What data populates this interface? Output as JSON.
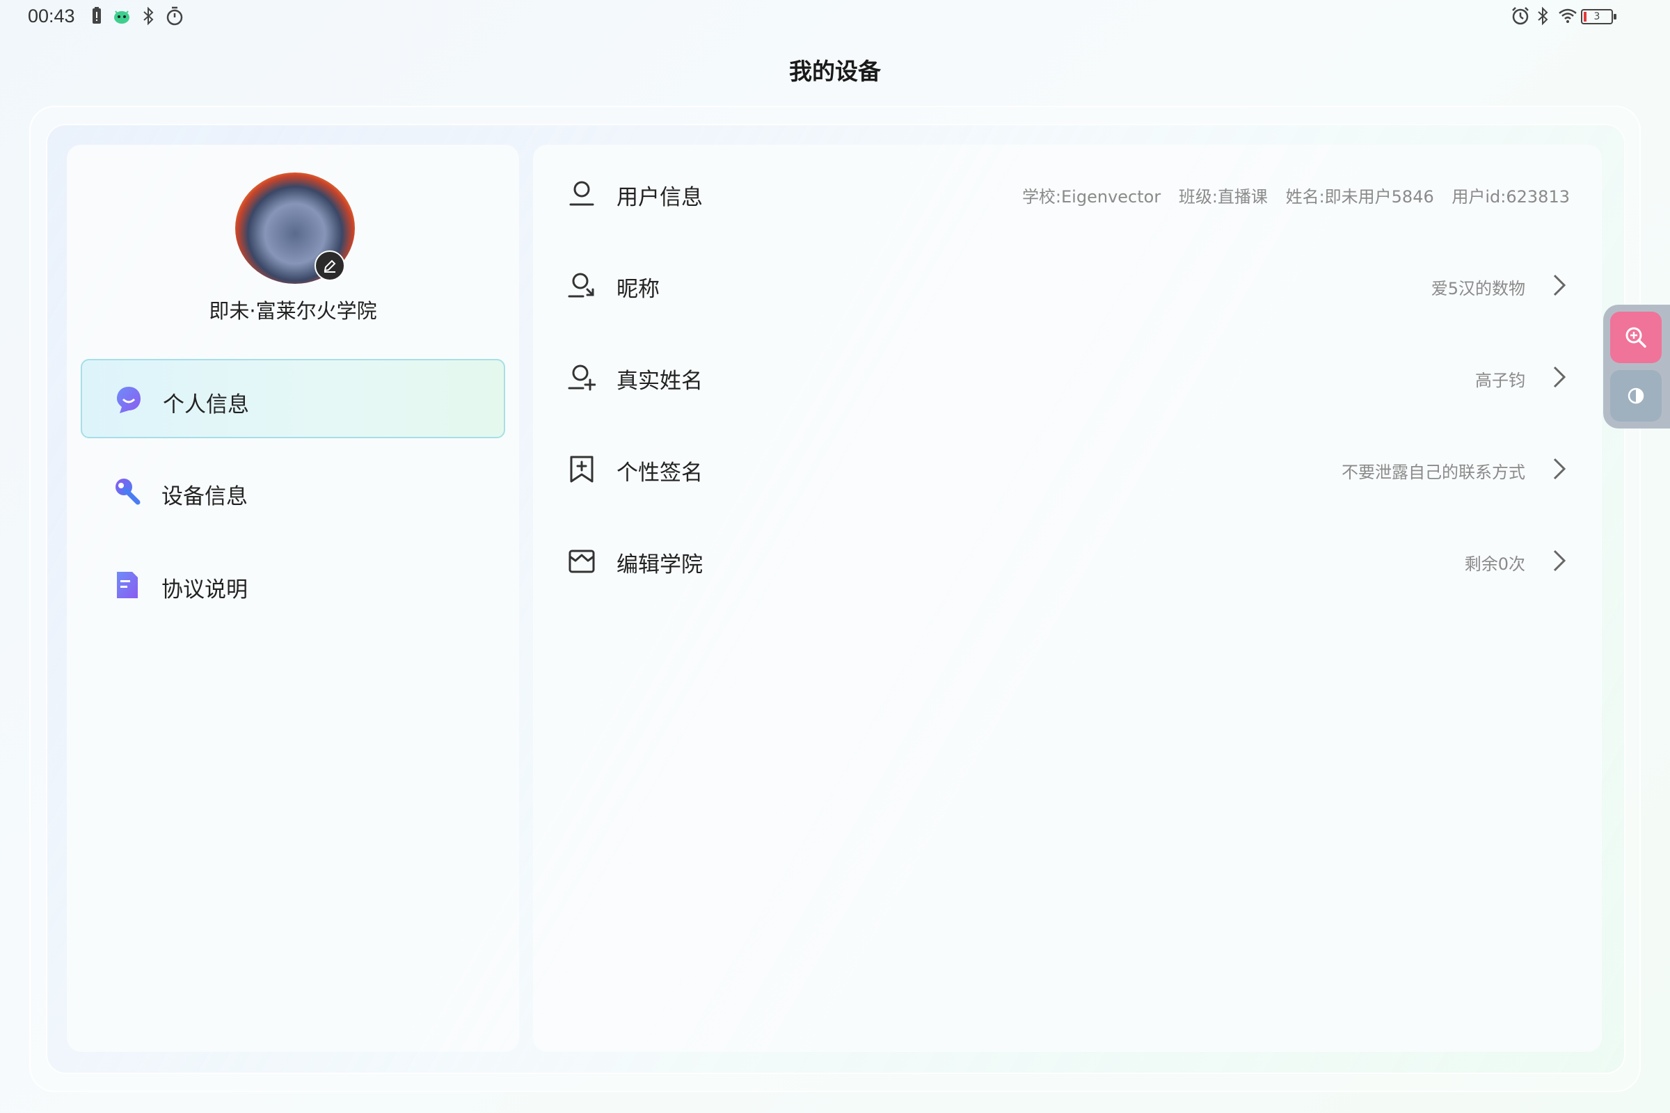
{
  "status_bar": {
    "time": "00:43",
    "battery_level": "3",
    "left_icons": [
      "battery-alert-icon",
      "android-icon",
      "bluetooth-icon",
      "timer-icon"
    ],
    "right_icons": [
      "alarm-icon",
      "bluetooth-icon",
      "wifi-icon",
      "battery-icon"
    ]
  },
  "page": {
    "title": "我的设备"
  },
  "profile": {
    "name": "即未·富莱尔火学院"
  },
  "sidebar": {
    "items": [
      {
        "label": "个人信息",
        "icon": "personal-info-icon",
        "active": true
      },
      {
        "label": "设备信息",
        "icon": "device-info-icon",
        "active": false
      },
      {
        "label": "协议说明",
        "icon": "agreement-icon",
        "active": false
      }
    ]
  },
  "user_info": {
    "label": "用户信息",
    "school": "学校:Eigenvector",
    "class": "班级:直播课",
    "name": "姓名:即未用户5846",
    "user_id": "用户id:623813"
  },
  "rows": [
    {
      "label": "昵称",
      "value": "爱5汉的数物",
      "icon": "user-edit-icon"
    },
    {
      "label": "真实姓名",
      "value": "高子钧",
      "icon": "user-add-icon"
    },
    {
      "label": "个性签名",
      "value": "不要泄露自己的联系方式",
      "icon": "bookmark-plus-icon"
    },
    {
      "label": "编辑学院",
      "value": "剩余0次",
      "icon": "college-icon"
    }
  ],
  "colors": {
    "accent_active_border": "#a6dfe7",
    "zoom_button": "#f0739a",
    "icon_purple": "#7a5af0",
    "icon_blue": "#4a7cf2"
  }
}
